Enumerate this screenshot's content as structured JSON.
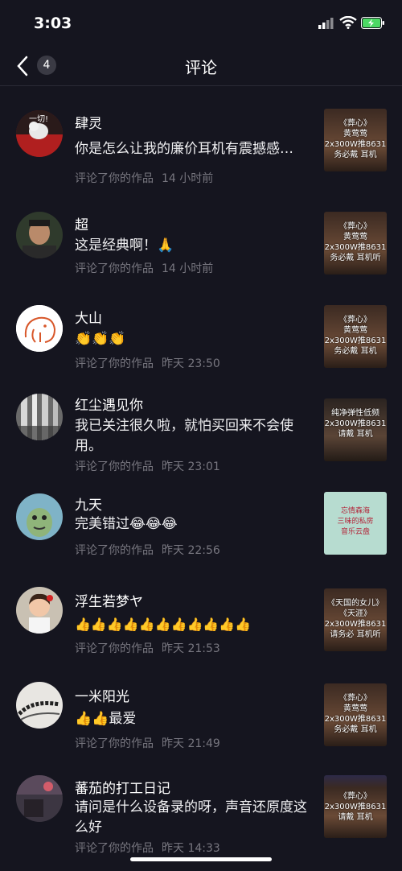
{
  "status": {
    "time": "3:03"
  },
  "nav": {
    "badge": "4",
    "title": "评论"
  },
  "items": [
    {
      "name": "肆灵",
      "text": "你是怎么让我的廉价耳机有震撼感…",
      "action": "评论了你的作品",
      "time": "14 小时前",
      "thumb": [
        "《葬心》",
        "黄莺莺",
        "2x300W推8631",
        "务必戴 耳机"
      ],
      "avatar_text": "一切!"
    },
    {
      "name": "超",
      "text": "这是经典啊！🙏",
      "action": "评论了你的作品",
      "time": "14 小时前",
      "thumb": [
        "《葬心》",
        "黄莺莺",
        "2x300W推8631",
        "务必戴 耳机听"
      ]
    },
    {
      "name": "大山",
      "text": "👏👏👏",
      "action": "评论了你的作品",
      "time": "昨天 23:50",
      "thumb": [
        "《葬心》",
        "黄莺莺",
        "2x300W推8631",
        "务必戴 耳机"
      ]
    },
    {
      "name": "红尘遇见你",
      "text": "我已关注很久啦，就怕买回来不会使用。",
      "action": "评论了你的作品",
      "time": "昨天 23:01",
      "thumb": [
        "纯净弹性低频",
        "2x300W推8631",
        "请戴 耳机"
      ]
    },
    {
      "name": "九天",
      "text": "完美错过😂😂😂",
      "action": "评论了你的作品",
      "time": "昨天 22:56",
      "thumb": [
        "忘情森海",
        "三味的私房",
        "音乐云盘"
      ]
    },
    {
      "name": "浮生若梦ヤ",
      "text": "👍👍👍👍👍👍👍👍👍👍👍",
      "action": "评论了你的作品",
      "time": "昨天 21:53",
      "thumb": [
        "《天国的女儿》",
        "《天涯》",
        "2x300W推8631",
        "请务必 耳机听"
      ]
    },
    {
      "name": "一米阳光",
      "text": "👍👍最爱",
      "action": "评论了你的作品",
      "time": "昨天 21:49",
      "thumb": [
        "《葬心》",
        "黄莺莺",
        "2x300W推8631",
        "务必戴 耳机"
      ]
    },
    {
      "name": "蕃茄的打工日记",
      "text": "请问是什么设备录的呀，声音还原度这么好",
      "action": "评论了你的作品",
      "time": "昨天 14:33",
      "thumb": [
        "《葬心》",
        "2x300W推8631",
        "请戴 耳机"
      ]
    }
  ]
}
